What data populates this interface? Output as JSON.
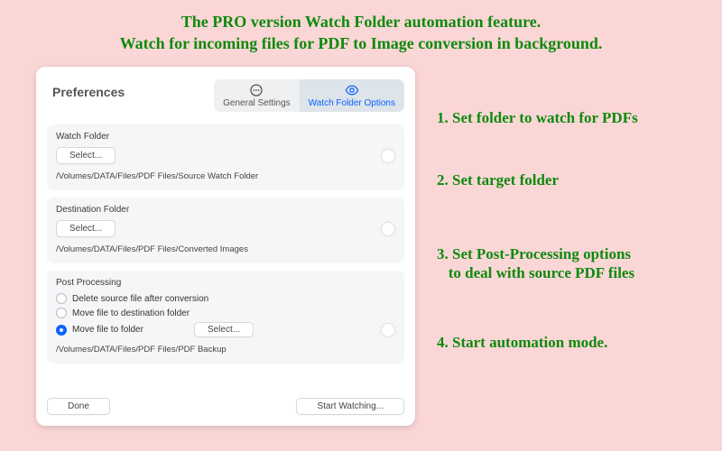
{
  "headline": {
    "line1": "The PRO version Watch Folder automation feature.",
    "line2": "Watch for incoming files for PDF to Image conversion in background."
  },
  "window": {
    "title": "Preferences",
    "tabs": {
      "general": "General Settings",
      "watchfolder": "Watch Folder Options"
    },
    "watch_folder": {
      "label": "Watch Folder",
      "select_label": "Select...",
      "path": "/Volumes/DATA/Files/PDF Files/Source Watch Folder"
    },
    "destination_folder": {
      "label": "Destination Folder",
      "select_label": "Select...",
      "path": "/Volumes/DATA/Files/PDF Files/Converted Images"
    },
    "post_processing": {
      "label": "Post Processing",
      "opt_delete": "Delete source file after conversion",
      "opt_move_dest": "Move file to destination folder",
      "opt_move_folder": "Move file to folder",
      "select_label": "Select...",
      "path": "/Volumes/DATA/Files/PDF Files/PDF Backup"
    },
    "footer": {
      "done": "Done",
      "start": "Start Watching..."
    }
  },
  "annotations": {
    "a1": "1. Set folder to watch for PDFs",
    "a2": "2. Set target folder",
    "a3_l1": "3. Set Post-Processing options",
    "a3_l2": "   to deal with source PDF files",
    "a4": "4. Start automation mode."
  }
}
